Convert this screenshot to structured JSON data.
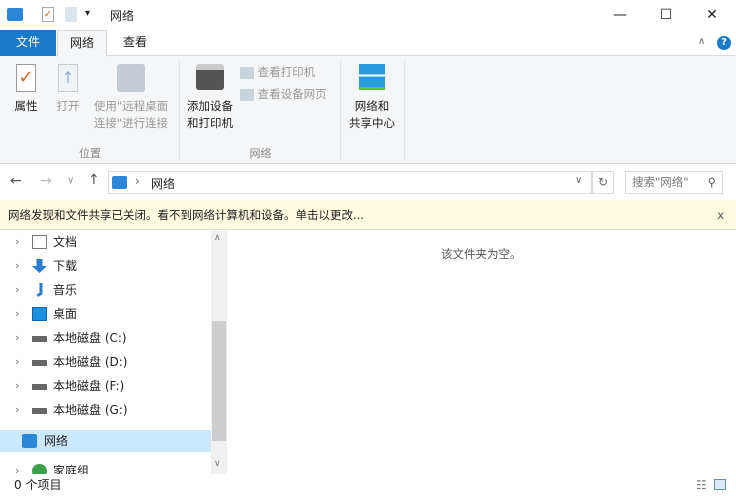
{
  "title": "网络",
  "tabs": {
    "file": "文件",
    "network": "网络",
    "view": "查看"
  },
  "ribbon": {
    "properties": "属性",
    "open": "打开",
    "remote_line1": "使用\"远程桌面",
    "remote_line2": "连接\"进行连接",
    "group_location": "位置",
    "add_line1": "添加设备",
    "add_line2": "和打印机",
    "view_printers": "查看打印机",
    "view_device_page": "查看设备网页",
    "group_network": "网络",
    "center_line1": "网络和",
    "center_line2": "共享中心"
  },
  "address": {
    "path": "网络",
    "search_placeholder": "搜索\"网络\""
  },
  "infobar": {
    "text": "网络发现和文件共享已关闭。看不到网络计算机和设备。单击以更改...",
    "close": "x"
  },
  "nav": [
    {
      "label": "文档",
      "icon": "documents-icon"
    },
    {
      "label": "下载",
      "icon": "download-icon"
    },
    {
      "label": "音乐",
      "icon": "music-icon"
    },
    {
      "label": "桌面",
      "icon": "desktop-icon"
    },
    {
      "label": "本地磁盘 (C:)",
      "icon": "drive-icon"
    },
    {
      "label": "本地磁盘 (D:)",
      "icon": "drive-icon"
    },
    {
      "label": "本地磁盘 (F:)",
      "icon": "drive-icon"
    },
    {
      "label": "本地磁盘 (G:)",
      "icon": "drive-icon"
    },
    {
      "label": "网络",
      "icon": "network-icon"
    },
    {
      "label": "家庭组",
      "icon": "homegroup-icon"
    }
  ],
  "content": {
    "empty": "该文件夹为空。"
  },
  "status": {
    "count": "0 个项目"
  },
  "colors": {
    "accent": "#1979ca",
    "selected": "#cce8ff",
    "infobar": "#fefbe0"
  }
}
